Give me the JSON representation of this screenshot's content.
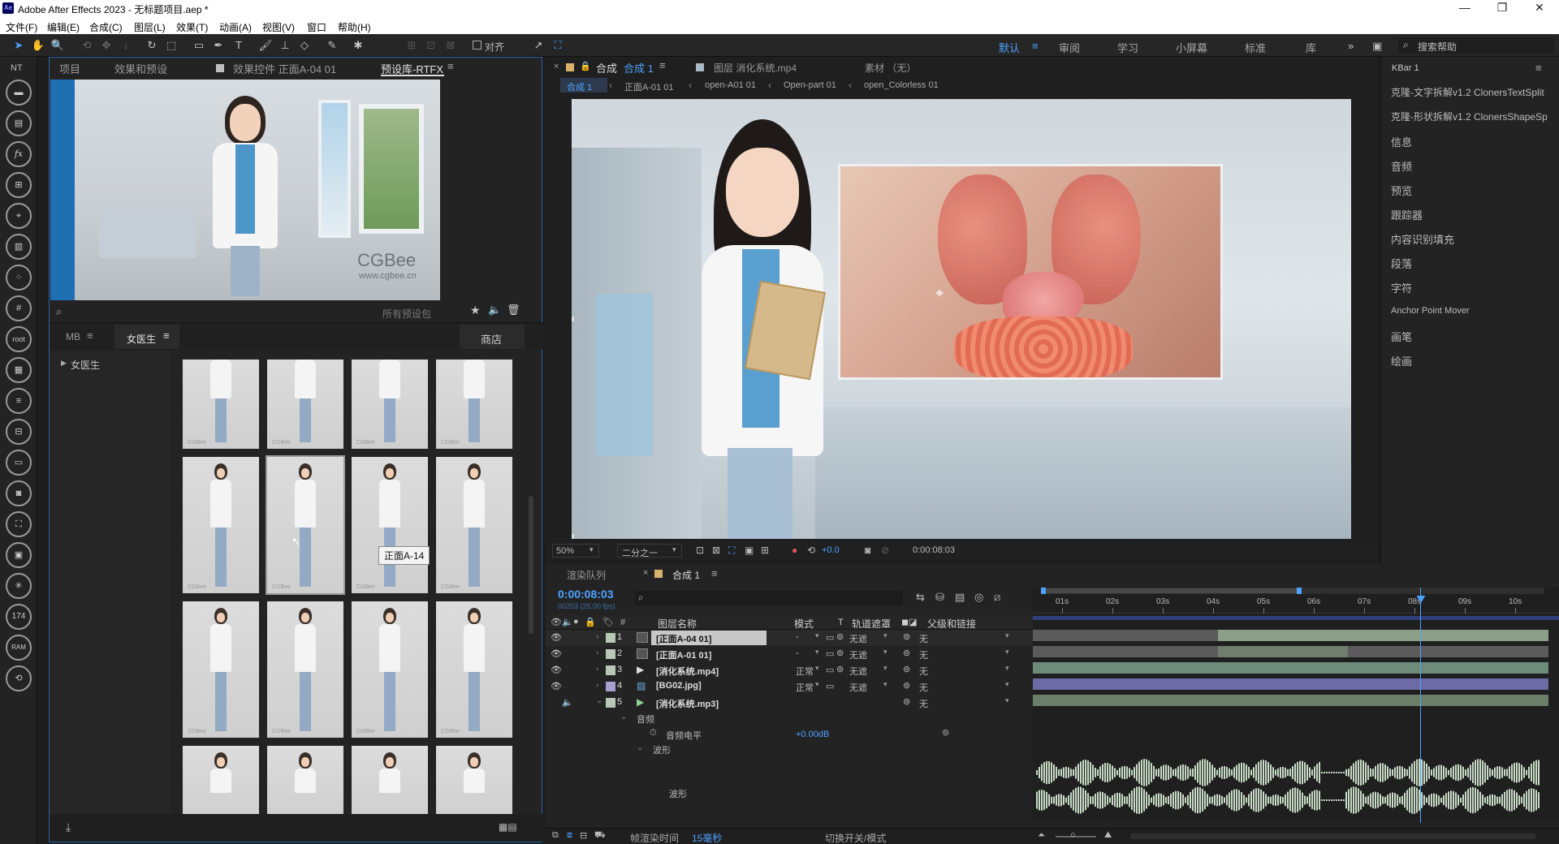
{
  "window": {
    "logo": "Ae",
    "title": "Adobe After Effects 2023 - 无标题项目.aep *",
    "controls": [
      "—",
      "❐",
      "✕"
    ]
  },
  "menu": [
    "文件(F)",
    "编辑(E)",
    "合成(C)",
    "图层(L)",
    "效果(T)",
    "动画(A)",
    "视图(V)",
    "窗口",
    "帮助(H)"
  ],
  "toolbar": {
    "snap_label": "对齐",
    "workspaces": [
      "默认",
      "审阅",
      "学习",
      "小屏幕",
      "标准",
      "库"
    ],
    "more": "»",
    "search_placeholder": "搜索帮助"
  },
  "left_strip": {
    "top_label": "NT",
    "icons": [
      "car-icon",
      "monitor-icon",
      "fx-styles-icon",
      "add-image-icon",
      "crosshair-icon",
      "text-box-icon",
      "particles-icon",
      "grid-icon",
      "root-icon",
      "folder-icon",
      "align-icon",
      "layout-icon",
      "window-icon",
      "camera-icon",
      "transform-icon",
      "display-icon",
      "sparkle-icon",
      "counter-icon",
      "ram-icon",
      "history-icon"
    ],
    "counter": "174",
    "ram": "RAM",
    "fx": "fx",
    "root": "root"
  },
  "project_panel": {
    "tabs": [
      "项目",
      "效果和预设",
      "效果控件 正面A-04 01",
      "预设库-RTFX"
    ],
    "preview_brand": "CGBee",
    "preview_url": "www.cgbee.cn",
    "search_placeholder": "所有预设包",
    "sub_tabs": [
      "MB",
      "女医生",
      "商店"
    ],
    "tree_item": "女医生",
    "tooltip": "正面A-14",
    "thumb_watermark": "CGBee"
  },
  "viewer": {
    "tabs": [
      "合成",
      "合成 1",
      "图层 消化系统.mp4",
      "素材 （无）"
    ],
    "breadcrumbs": [
      "合成 1",
      "正面A-01 01",
      "open-A01 01",
      "Open-part 01",
      "open_Colorless 01"
    ],
    "zoom": "50%",
    "resolution": "二分之一",
    "exposure": "+0.0",
    "timecode": "0:00:08:03"
  },
  "right_panel": {
    "title": "KBar 1",
    "items": [
      "克隆-文字拆解v1.2 ClonersTextSplit",
      "克隆-形状拆解v1.2 ClonersShapeSp",
      "信息",
      "音频",
      "预览",
      "跟踪器",
      "内容识别填充",
      "段落",
      "字符",
      "Anchor Point Mover",
      "画笔",
      "绘画"
    ]
  },
  "timeline": {
    "tabs": [
      "渲染队列",
      "合成 1"
    ],
    "timecode": "0:00:08:03",
    "fps": "00203 (25.00 fps)",
    "headers": {
      "num": "#",
      "name": "图层名称",
      "mode": "模式",
      "t": "T",
      "track": "轨道遮罩",
      "parent": "父级和链接"
    },
    "layers": [
      {
        "num": "1",
        "name": "[正面A-04 01]",
        "mode": "-",
        "track": "无遮",
        "parent": "无",
        "color": "#b7c9b5"
      },
      {
        "num": "2",
        "name": "[正面A-01 01]",
        "mode": "-",
        "track": "无遮",
        "parent": "无",
        "color": "#b7c9b5"
      },
      {
        "num": "3",
        "name": "[消化系统.mp4]",
        "mode": "正常",
        "track": "无遮",
        "parent": "无",
        "color": "#b7c9b5"
      },
      {
        "num": "4",
        "name": "[BG02.jpg]",
        "mode": "正常",
        "track": "无遮",
        "parent": "无",
        "color": "#a79fd0"
      },
      {
        "num": "5",
        "name": "[消化系统.mp3]",
        "mode": "",
        "track": "",
        "parent": "无",
        "color": "#b7c9b5"
      }
    ],
    "audio_group": "音频",
    "audio_level_label": "音频电平",
    "audio_level_value": "+0.00dB",
    "waveform_group": "波形",
    "waveform_label": "波形",
    "ruler": [
      "01s",
      "02s",
      "03s",
      "04s",
      "05s",
      "06s",
      "07s",
      "08s",
      "09s",
      "10s"
    ],
    "footer_render_label": "帧渲染时间",
    "footer_render_value": "15毫秒",
    "footer_toggle": "切换开关/模式",
    "playhead_time_sec": 8.12
  }
}
